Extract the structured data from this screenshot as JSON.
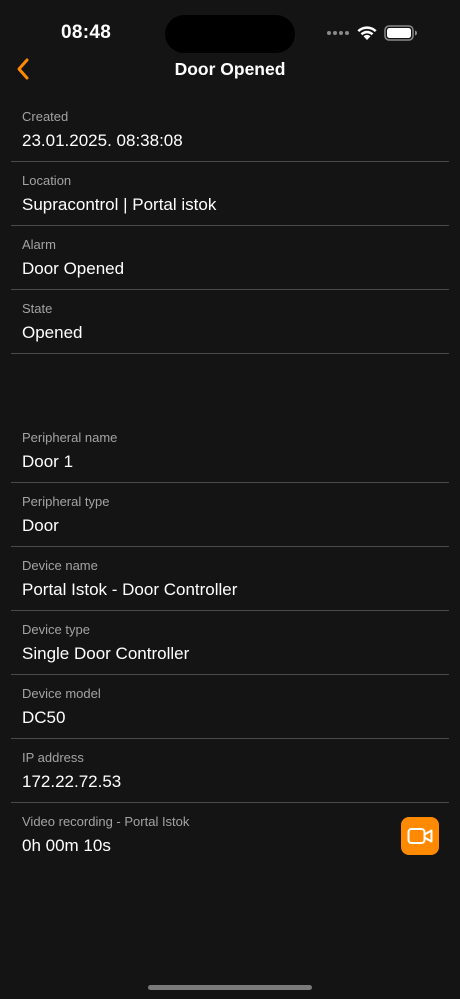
{
  "status_bar": {
    "time": "08:48"
  },
  "header": {
    "title": "Door Opened",
    "back_icon": "chevron-left-icon",
    "accent_color": "#ff8a00"
  },
  "alarm_fields": [
    {
      "label": "Created",
      "value": "23.01.2025. 08:38:08"
    },
    {
      "label": "Location",
      "value": "Supracontrol | Portal istok"
    },
    {
      "label": "Alarm",
      "value": "Door Opened"
    },
    {
      "label": "State",
      "value": "Opened"
    }
  ],
  "peripheral_fields": [
    {
      "label": "Peripheral name",
      "value": "Door 1"
    },
    {
      "label": "Peripheral type",
      "value": "Door"
    },
    {
      "label": "Device name",
      "value": "Portal Istok - Door Controller"
    },
    {
      "label": "Device type",
      "value": "Single Door Controller"
    },
    {
      "label": "Device model",
      "value": "DC50"
    },
    {
      "label": "IP address",
      "value": "172.22.72.53"
    }
  ],
  "video_recording": {
    "label": "Video recording - Portal Istok",
    "duration": "0h 00m 10s",
    "button_icon": "video-camera-icon"
  }
}
